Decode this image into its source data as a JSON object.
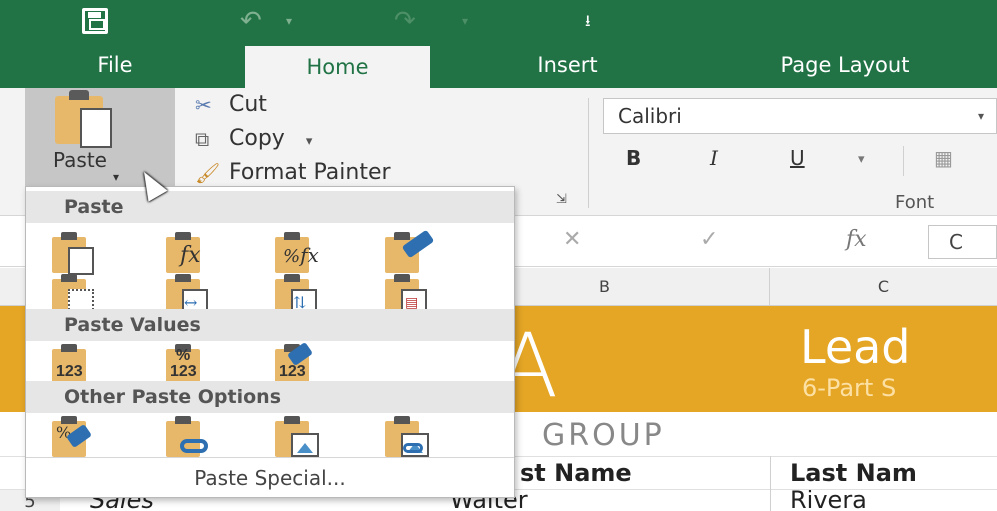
{
  "quick_access": {
    "undo_dropdown": "▾",
    "redo_dropdown": "▾",
    "customize": "⭳"
  },
  "tabs": [
    {
      "label": "File"
    },
    {
      "label": "Home"
    },
    {
      "label": "Insert"
    },
    {
      "label": "Page Layout"
    }
  ],
  "clipboard": {
    "paste_label": "Paste",
    "paste_caret": "▾",
    "cut_label": "Cut",
    "copy_label": "Copy",
    "copy_dropdown": "▾",
    "format_painter_label": "Format Painter",
    "launcher": "⇲"
  },
  "font": {
    "name": "Calibri",
    "dropdown": "▾",
    "bold": "B",
    "italic": "I",
    "underline": "U",
    "underline_dropdown": "▾",
    "group_label": "Font"
  },
  "formula_bar": {
    "cancel": "✕",
    "enter": "✓",
    "fx": "fx",
    "value": "C"
  },
  "columns": [
    "B",
    "C"
  ],
  "sheet": {
    "banner_big": "TA",
    "banner_title": "Lead",
    "banner_subtitle": "6-Part S",
    "group_text": "GROUP",
    "header_first_name": "st Name",
    "header_last_name": "Last Nam",
    "row_number": "5",
    "row_dept": "Sales",
    "row_first_name": "Walter",
    "row_last_name": "Rivera"
  },
  "paste_menu": {
    "section_paste": "Paste",
    "section_values": "Paste Values",
    "section_other": "Other Paste Options",
    "paste_special": "Paste Special...",
    "fx_glyph": "fx",
    "percent_glyph": "%",
    "values_glyph": "123"
  }
}
